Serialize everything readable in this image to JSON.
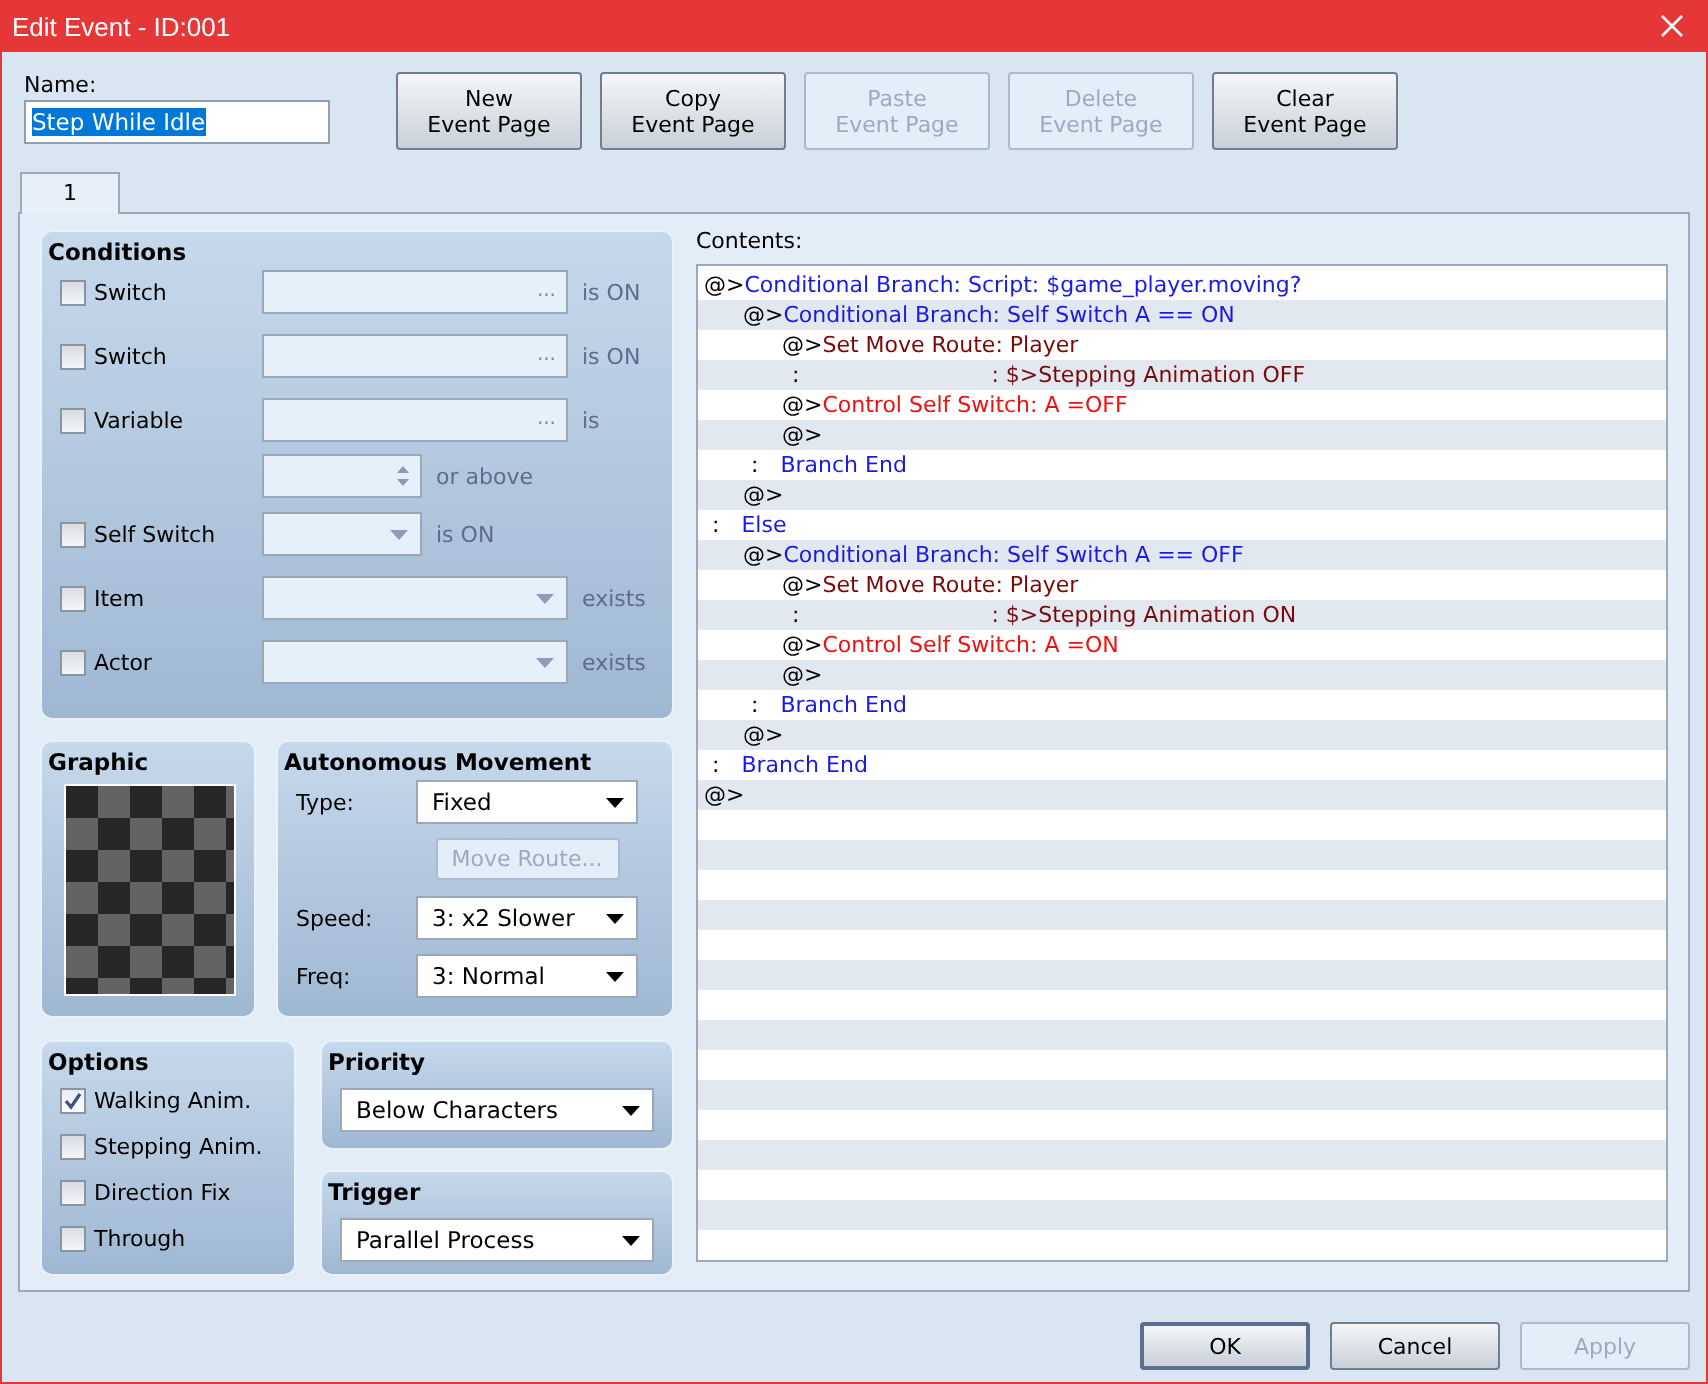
{
  "window": {
    "title": "Edit Event - ID:001"
  },
  "name": {
    "label": "Name:",
    "value": "Step While Idle",
    "selected": true
  },
  "page_buttons": [
    {
      "label": "New\nEvent Page",
      "disabled": false
    },
    {
      "label": "Copy\nEvent Page",
      "disabled": false
    },
    {
      "label": "Paste\nEvent Page",
      "disabled": true
    },
    {
      "label": "Delete\nEvent Page",
      "disabled": true
    },
    {
      "label": "Clear\nEvent Page",
      "disabled": false
    }
  ],
  "tabs": [
    {
      "label": "1",
      "selected": true
    }
  ],
  "conditions": {
    "title": "Conditions",
    "rows": [
      {
        "kind": "picker",
        "label": "Switch",
        "checked": false,
        "button": "...",
        "suffix": "is ON"
      },
      {
        "kind": "picker",
        "label": "Switch",
        "checked": false,
        "button": "...",
        "suffix": "is ON"
      },
      {
        "kind": "picker",
        "label": "Variable",
        "checked": false,
        "button": "...",
        "suffix": "is"
      },
      {
        "kind": "spin",
        "suffix": "or above"
      },
      {
        "kind": "short-combo",
        "label": "Self Switch",
        "checked": false,
        "suffix": "is ON"
      },
      {
        "kind": "combo",
        "label": "Item",
        "checked": false,
        "suffix": "exists"
      },
      {
        "kind": "combo",
        "label": "Actor",
        "checked": false,
        "suffix": "exists"
      }
    ]
  },
  "graphic": {
    "title": "Graphic"
  },
  "movement": {
    "title": "Autonomous Movement",
    "fields": [
      {
        "kind": "combo",
        "label": "Type:",
        "value": "Fixed"
      },
      {
        "kind": "button",
        "label": "Move Route...",
        "disabled": true
      },
      {
        "kind": "combo",
        "label": "Speed:",
        "value": "3: x2 Slower"
      },
      {
        "kind": "combo",
        "label": "Freq:",
        "value": "3: Normal"
      }
    ]
  },
  "options": {
    "title": "Options",
    "items": [
      {
        "label": "Walking Anim.",
        "checked": true
      },
      {
        "label": "Stepping Anim.",
        "checked": false
      },
      {
        "label": "Direction Fix",
        "checked": false
      },
      {
        "label": "Through",
        "checked": false
      }
    ]
  },
  "priority": {
    "title": "Priority",
    "value": "Below Characters"
  },
  "trigger": {
    "title": "Trigger",
    "value": "Parallel Process"
  },
  "contents": {
    "label": "Contents:",
    "commands": [
      {
        "marker": "@>",
        "text": "Conditional Branch: Script: $game_player.moving?",
        "kind": "branch",
        "children": [
          {
            "marker": "@>",
            "text": "Conditional Branch: Self Switch A == ON",
            "kind": "branch",
            "children": [
              {
                "marker": "@>",
                "text": "Set Move Route: Player",
                "kind": "route"
              },
              {
                "marker": ":",
                "text": ": $>Stepping Animation OFF",
                "kind": "continue"
              },
              {
                "marker": "@>",
                "text": "Control Self Switch: A =OFF",
                "kind": "switch"
              },
              {
                "marker": "@>",
                "kind": "empty"
              }
            ]
          },
          {
            "marker": ":",
            "text": "Branch End",
            "kind": "end"
          },
          {
            "marker": "@>",
            "kind": "empty"
          }
        ]
      },
      {
        "marker": ":",
        "text": "Else",
        "kind": "end",
        "children": [
          {
            "marker": "@>",
            "text": "Conditional Branch: Self Switch A == OFF",
            "kind": "branch",
            "children": [
              {
                "marker": "@>",
                "text": "Set Move Route: Player",
                "kind": "route"
              },
              {
                "marker": ":",
                "text": ": $>Stepping Animation ON",
                "kind": "continue"
              },
              {
                "marker": "@>",
                "text": "Control Self Switch: A =ON",
                "kind": "switch"
              },
              {
                "marker": "@>",
                "kind": "empty"
              }
            ]
          },
          {
            "marker": ":",
            "text": "Branch End",
            "kind": "end"
          },
          {
            "marker": "@>",
            "kind": "empty"
          }
        ]
      },
      {
        "marker": ":",
        "text": "Branch End",
        "kind": "end"
      },
      {
        "marker": "@>",
        "kind": "empty"
      }
    ]
  },
  "footer_buttons": [
    {
      "label": "OK",
      "disabled": false,
      "default": true
    },
    {
      "label": "Cancel",
      "disabled": false,
      "default": false
    },
    {
      "label": "Apply",
      "disabled": true,
      "default": false
    }
  ]
}
